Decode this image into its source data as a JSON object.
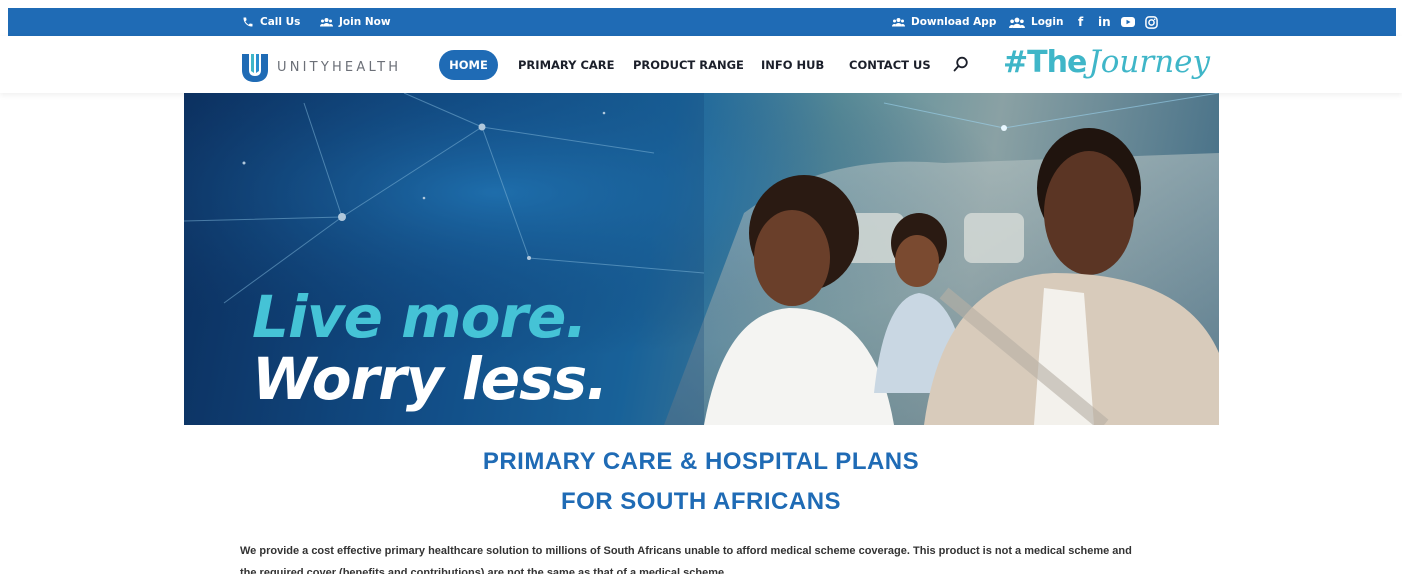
{
  "topbar": {
    "call_us": "Call Us",
    "join_now": "Join Now",
    "download_app": "Download App",
    "login": "Login",
    "social": [
      "facebook-icon",
      "linkedin-icon",
      "youtube-icon",
      "instagram-icon"
    ],
    "bg_color": "#1f6bb5"
  },
  "header": {
    "logo_text": "UNITYHEALTH",
    "nav": {
      "home": "HOME",
      "primary_care": "PRIMARY CARE",
      "product_range": "PRODUCT RANGE",
      "info_hub": "INFO HUB",
      "contact_us": "CONTACT US"
    },
    "journey_hash": "#The",
    "journey_script": "Journey",
    "accent_color": "#3fb6c8"
  },
  "hero": {
    "line1": "Live more.",
    "line2": "Worry less."
  },
  "main": {
    "heading_line1": "PRIMARY CARE & HOSPITAL PLANS",
    "heading_line2": "FOR SOUTH AFRICANS",
    "intro_line1": "We provide a cost effective primary healthcare solution to millions of South Africans unable to afford medical scheme coverage. This product is not a medical scheme and",
    "intro_line2": "the required cover (benefits and contributions) are not the same as that of a medical scheme."
  }
}
